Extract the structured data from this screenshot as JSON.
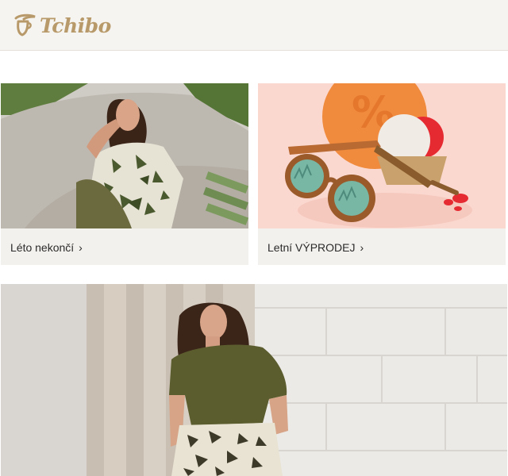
{
  "header": {
    "logo_text": "Tchibo"
  },
  "cards": [
    {
      "caption": "Léto nekončí",
      "chevron": "›",
      "image": "woman-in-leaf-print-outfit-photo"
    },
    {
      "caption": "Letní VÝPRODEJ",
      "chevron": "›",
      "image": "sunglasses-and-ice-cream-sale-photo"
    }
  ],
  "banner": {
    "image": "woman-in-olive-top-photo"
  },
  "colors": {
    "brand_gold": "#b89a6a",
    "header_bg": "#f6f4f0",
    "card_bg": "#f3f1ed",
    "sale_bg": "#fbd8cf"
  }
}
